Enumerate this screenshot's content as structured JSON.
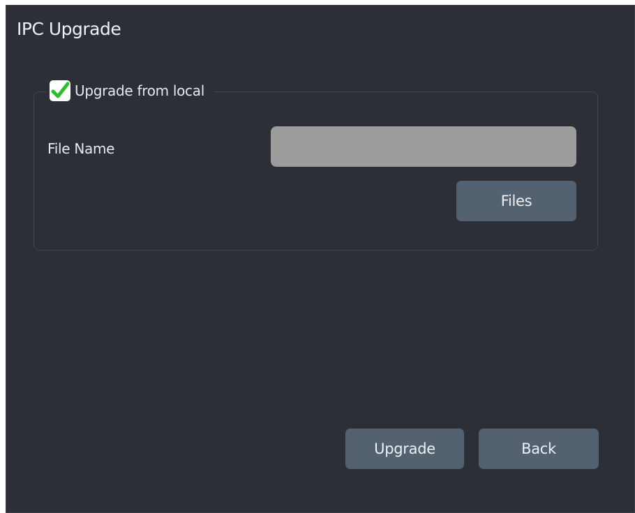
{
  "window": {
    "title": "IPC Upgrade"
  },
  "local_upgrade": {
    "checkbox_label": "Upgrade from local",
    "checked": true,
    "check_icon": "check-icon",
    "check_color": "#2bbf2b",
    "file_name_label": "File Name",
    "file_name_value": "",
    "files_button_label": "Files"
  },
  "footer": {
    "upgrade_button_label": "Upgrade",
    "back_button_label": "Back"
  },
  "colors": {
    "dialog_background": "#2c2f36",
    "button_background": "#536170",
    "input_background": "#9c9c9c",
    "text": "#eef0f3"
  }
}
